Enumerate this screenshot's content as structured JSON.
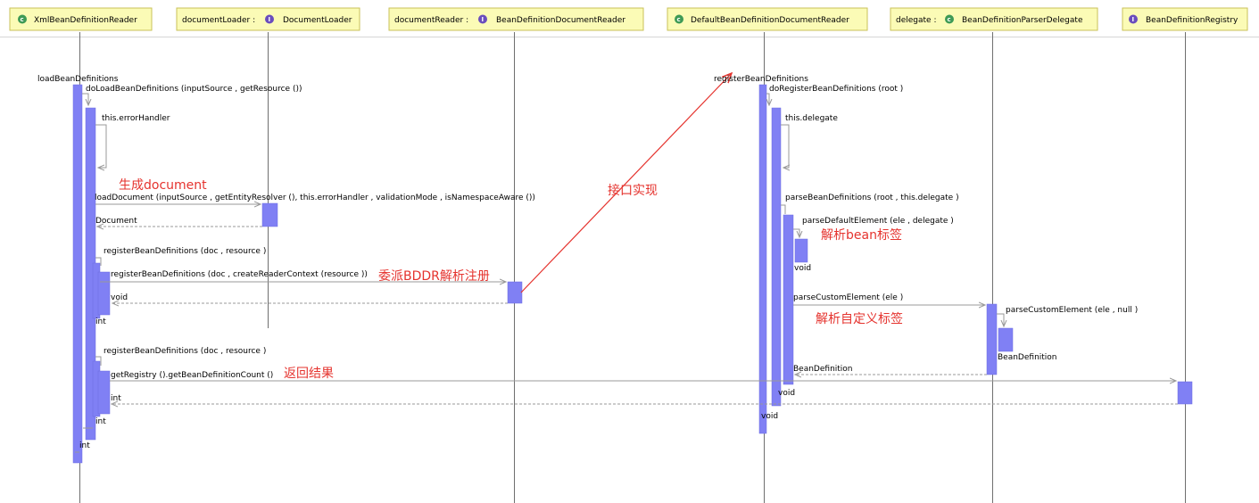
{
  "lifelines": [
    {
      "name": "XmlBeanDefinitionReader",
      "var": "",
      "kind": "class"
    },
    {
      "name": "DocumentLoader",
      "var": "documentLoader :",
      "kind": "interface"
    },
    {
      "name": "BeanDefinitionDocumentReader",
      "var": "documentReader :",
      "kind": "interface"
    },
    {
      "name": "DefaultBeanDefinitionDocumentReader",
      "var": "",
      "kind": "class"
    },
    {
      "name": "BeanDefinitionParserDelegate",
      "var": "delegate :",
      "kind": "class"
    },
    {
      "name": "BeanDefinitionRegistry",
      "var": "",
      "kind": "interface"
    }
  ],
  "messages": {
    "m1": "loadBeanDefinitions",
    "m2": "doLoadBeanDefinitions    (inputSource  , getResource   ())",
    "m3": "this.errorHandler",
    "m4": "loadDocument    (inputSource  , getEntityResolver    (), this.errorHandler   , validationMode   , isNamespaceAware    ())",
    "m5": "Document",
    "m6": "registerBeanDefinitions    (doc , resource  )",
    "m7": "registerBeanDefinitions    (doc , createReaderContext    (resource  ))",
    "m8": "void",
    "m9": "int",
    "m10": "registerBeanDefinitions    (doc , resource  )",
    "m11": "getRegistry   ().getBeanDefinitionCount     ()",
    "m12": "int",
    "m13": "int",
    "m14": "int",
    "m15": "registerBeanDefinitions",
    "m16": "doRegisterBeanDefinitions     (root )",
    "m17": "this.delegate",
    "m18": "parseBeanDefinitions    (root , this.delegate  )",
    "m19": "parseDefaultElement    (ele , delegate  )",
    "m20": "void",
    "m21": "parseCustomElement    (ele )",
    "m22": "parseCustomElement    (ele , null )",
    "m23": "BeanDefinition",
    "m24": "BeanDefinition",
    "m25": "void",
    "m26": "void"
  },
  "annotations": {
    "a1": "生成document",
    "a2": "委派BDDR解析注册",
    "a3": "接口实现",
    "a4": "解析bean标签",
    "a5": "解析自定义标签",
    "a6": "返回结果"
  },
  "colors": {
    "header_bg": "#fbfbb6",
    "activation": "#8080f4",
    "annotation": "#e5332e"
  }
}
